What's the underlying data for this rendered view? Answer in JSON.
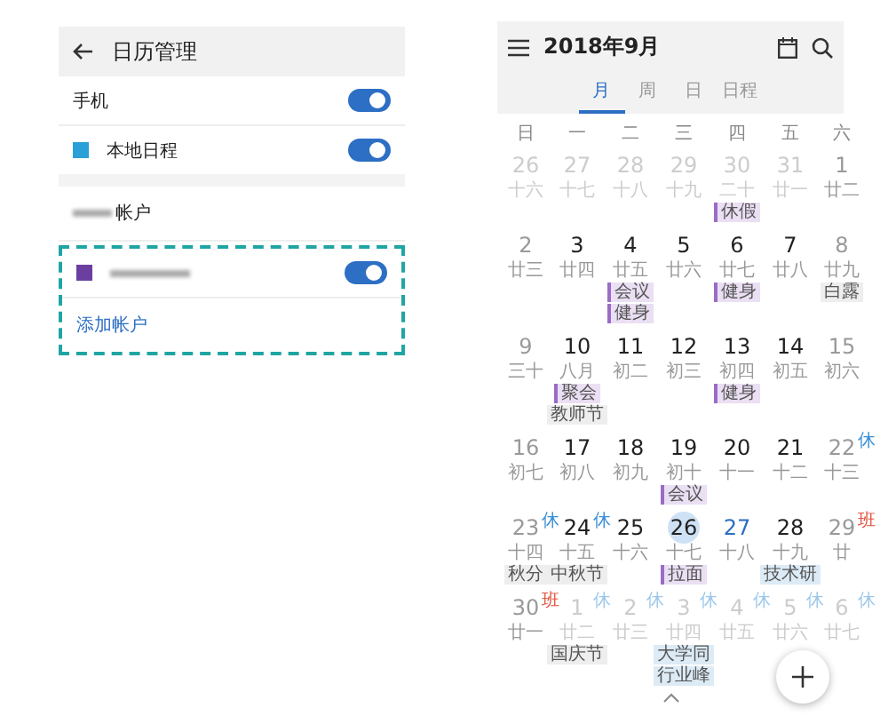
{
  "settings": {
    "title": "日历管理",
    "rows": [
      {
        "kind": "toggle",
        "label": "手机",
        "on": true
      },
      {
        "kind": "calendar",
        "label": "本地日程",
        "color": "#2a9fd8",
        "on": true
      },
      {
        "kind": "divider"
      },
      {
        "kind": "account-header",
        "label": "帐户"
      },
      {
        "kind": "account",
        "color": "#6b3fa0",
        "on": true,
        "highlighted": true
      },
      {
        "kind": "link",
        "label": "添加帐户",
        "highlighted": true
      }
    ]
  },
  "calendar": {
    "title": "2018年9月",
    "tabs": [
      {
        "label": "月",
        "selected": true
      },
      {
        "label": "周",
        "selected": false
      },
      {
        "label": "日",
        "selected": false
      },
      {
        "label": "日程",
        "selected": false
      }
    ],
    "weekdays": [
      "日",
      "一",
      "二",
      "三",
      "四",
      "五",
      "六"
    ],
    "weeks": [
      [
        {
          "day": "26",
          "lunar": "十六",
          "muted": true,
          "selected": false
        },
        {
          "day": "27",
          "lunar": "十七",
          "muted": true,
          "selected": false
        },
        {
          "day": "28",
          "lunar": "十八",
          "muted": true,
          "selected": false
        },
        {
          "day": "29",
          "lunar": "十九",
          "muted": true,
          "selected": false
        },
        {
          "day": "30",
          "lunar": "二十",
          "muted": true,
          "selected": false,
          "events": [
            {
              "text": "休假",
              "kind": "event",
              "color": "#eadff3"
            }
          ]
        },
        {
          "day": "31",
          "lunar": "廿一",
          "muted": true,
          "selected": false
        },
        {
          "day": "1",
          "lunar": "廿二",
          "muted": false,
          "selected": false
        }
      ],
      [
        {
          "day": "2",
          "lunar": "廿三",
          "muted": false,
          "selected": false
        },
        {
          "day": "3",
          "lunar": "廿四",
          "muted": false,
          "selected": false
        },
        {
          "day": "4",
          "lunar": "廿五",
          "muted": false,
          "selected": false,
          "events": [
            {
              "text": "会议",
              "kind": "event",
              "color": "#eadff3"
            },
            {
              "text": "健身",
              "kind": "event",
              "color": "#eadff3"
            }
          ]
        },
        {
          "day": "5",
          "lunar": "廿六",
          "muted": false,
          "selected": false
        },
        {
          "day": "6",
          "lunar": "廿七",
          "muted": false,
          "selected": false,
          "events": [
            {
              "text": "健身",
              "kind": "event",
              "color": "#eadff3"
            }
          ]
        },
        {
          "day": "7",
          "lunar": "廿八",
          "muted": false,
          "selected": false
        },
        {
          "day": "8",
          "lunar": "廿九",
          "muted": false,
          "selected": false,
          "events": [
            {
              "text": "白露",
              "kind": "holiday",
              "color": "#eeeeee"
            }
          ]
        }
      ],
      [
        {
          "day": "9",
          "lunar": "三十",
          "muted": false,
          "selected": false
        },
        {
          "day": "10",
          "lunar": "八月",
          "muted": false,
          "selected": false,
          "events": [
            {
              "text": "聚会",
              "kind": "event",
              "color": "#eadff3"
            },
            {
              "text": "教师节",
              "kind": "holiday",
              "color": "#eeeeee"
            }
          ]
        },
        {
          "day": "11",
          "lunar": "初二",
          "muted": false,
          "selected": false
        },
        {
          "day": "12",
          "lunar": "初三",
          "muted": false,
          "selected": false
        },
        {
          "day": "13",
          "lunar": "初四",
          "muted": false,
          "selected": false,
          "events": [
            {
              "text": "健身",
              "kind": "event",
              "color": "#eadff3"
            }
          ]
        },
        {
          "day": "14",
          "lunar": "初五",
          "muted": false,
          "selected": false
        },
        {
          "day": "15",
          "lunar": "初六",
          "muted": false,
          "selected": false
        }
      ],
      [
        {
          "day": "16",
          "lunar": "初七",
          "muted": false,
          "selected": false
        },
        {
          "day": "17",
          "lunar": "初八",
          "muted": false,
          "selected": false
        },
        {
          "day": "18",
          "lunar": "初九",
          "muted": false,
          "selected": false
        },
        {
          "day": "19",
          "lunar": "初十",
          "muted": false,
          "selected": false,
          "events": [
            {
              "text": "会议",
              "kind": "event",
              "color": "#eadff3"
            }
          ]
        },
        {
          "day": "20",
          "lunar": "十一",
          "muted": false,
          "selected": false
        },
        {
          "day": "21",
          "lunar": "十二",
          "muted": false,
          "selected": false
        },
        {
          "day": "22",
          "lunar": "十三",
          "muted": false,
          "selected": false,
          "mark": {
            "text": "休",
            "kind": "rest"
          }
        }
      ],
      [
        {
          "day": "23",
          "lunar": "十四",
          "muted": false,
          "selected": false,
          "mark": {
            "text": "休",
            "kind": "rest"
          },
          "events": [
            {
              "text": "秋分",
              "kind": "holiday",
              "color": "#eeeeee"
            }
          ]
        },
        {
          "day": "24",
          "lunar": "十五",
          "muted": false,
          "selected": false,
          "mark": {
            "text": "休",
            "kind": "rest"
          },
          "events": [
            {
              "text": "中秋节",
              "kind": "holiday",
              "color": "#eeeeee"
            }
          ]
        },
        {
          "day": "25",
          "lunar": "十六",
          "muted": false,
          "selected": false
        },
        {
          "day": "26",
          "lunar": "十七",
          "muted": false,
          "selected": true,
          "events": [
            {
              "text": "拉面",
              "kind": "event",
              "color": "#eadff3"
            }
          ]
        },
        {
          "day": "27",
          "lunar": "十八",
          "muted": false,
          "selected": false,
          "today": true
        },
        {
          "day": "28",
          "lunar": "十九",
          "muted": false,
          "selected": false,
          "events": [
            {
              "text": "技术研",
              "kind": "holiday",
              "color": "#dcebf6"
            }
          ]
        },
        {
          "day": "29",
          "lunar": "廿",
          "muted": false,
          "selected": false,
          "mark": {
            "text": "班",
            "kind": "work"
          }
        }
      ],
      [
        {
          "day": "30",
          "lunar": "廿一",
          "muted": false,
          "selected": false,
          "mark": {
            "text": "班",
            "kind": "work"
          }
        },
        {
          "day": "1",
          "lunar": "廿二",
          "muted": true,
          "selected": false,
          "mark": {
            "text": "休",
            "kind": "rest"
          },
          "events": [
            {
              "text": "国庆节",
              "kind": "holiday",
              "color": "#eeeeee"
            }
          ]
        },
        {
          "day": "2",
          "lunar": "廿三",
          "muted": true,
          "selected": false,
          "mark": {
            "text": "休",
            "kind": "rest"
          }
        },
        {
          "day": "3",
          "lunar": "廿四",
          "muted": true,
          "selected": false,
          "mark": {
            "text": "休",
            "kind": "rest"
          },
          "events": [
            {
              "text": "大学同",
              "kind": "holiday",
              "color": "#dcebf6"
            },
            {
              "text": "行业峰",
              "kind": "holiday",
              "color": "#dcebf6"
            }
          ]
        },
        {
          "day": "4",
          "lunar": "廿五",
          "muted": true,
          "selected": false,
          "mark": {
            "text": "休",
            "kind": "rest"
          }
        },
        {
          "day": "5",
          "lunar": "廿六",
          "muted": true,
          "selected": false,
          "mark": {
            "text": "休",
            "kind": "rest"
          }
        },
        {
          "day": "6",
          "lunar": "廿七",
          "muted": true,
          "selected": false,
          "mark": {
            "text": "休",
            "kind": "rest"
          }
        }
      ]
    ]
  }
}
